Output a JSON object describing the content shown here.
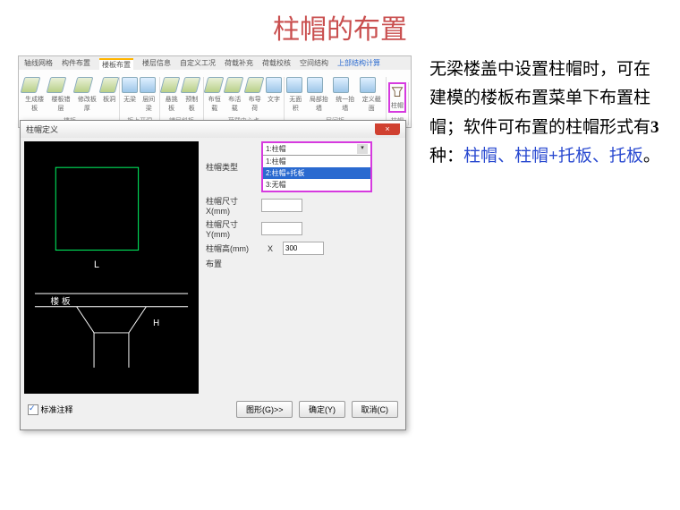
{
  "title": "柱帽的布置",
  "ribbon": {
    "tabs": [
      "轴线网格",
      "构件布置",
      "楼板布置",
      "楼层信息",
      "自定义工况",
      "荷载补充",
      "荷载校核",
      "空间结构",
      "上部结构计算"
    ],
    "active_index": 2,
    "buttons": {
      "b1": "生成楼板",
      "b2": "楼板错层",
      "b3": "修改板厚",
      "b4": "板洞",
      "b5": "无梁",
      "b6": "层间梁",
      "b7": "悬挑板",
      "b8": "预制板",
      "b9": "布恒载",
      "b10": "布活载",
      "b11": "布导荷",
      "b12": "文字",
      "b13": "无面积",
      "b14": "局部抬墙",
      "b15": "统一抬墙",
      "b16": "定义截面",
      "cap1": "柱帽"
    },
    "groups": {
      "g1": "楼板",
      "g2": "板上开洞",
      "g3": "错层斜板",
      "g4": "荷载中心点",
      "g5": "层间板",
      "g6": "柱帽"
    }
  },
  "dialog": {
    "title": "柱帽定义",
    "close": "×",
    "params": {
      "type_label": "柱帽类型",
      "x_label": "柱帽尺寸X(mm)",
      "y_label": "柱帽尺寸Y(mm)",
      "h_label": "柱帽高(mm)",
      "bj_label": "布置",
      "val_x": "",
      "val_y": "",
      "val_h": "300"
    },
    "dropdown": {
      "selected": "1:柱帽",
      "items": [
        "1:柱帽",
        "2:柱帽+托板",
        "3:无帽"
      ]
    },
    "footer": {
      "checkbox": "标准注释",
      "btn_graph": "图形(G)>>",
      "btn_ok": "确定(Y)",
      "btn_cancel": "取消(C)"
    },
    "preview": {
      "label_L": "L",
      "label_H": "H",
      "label_floor": "楼  板"
    }
  },
  "description": {
    "t1": "无梁楼盖中设置柱帽时，可在建模的楼板布置菜单下布置柱帽；软件可布置的柱帽形式有",
    "t2": "3",
    "t3": "种：",
    "h1": "柱帽、柱帽",
    "t4": "+",
    "h2": "托板、托板",
    "t5": "。"
  }
}
